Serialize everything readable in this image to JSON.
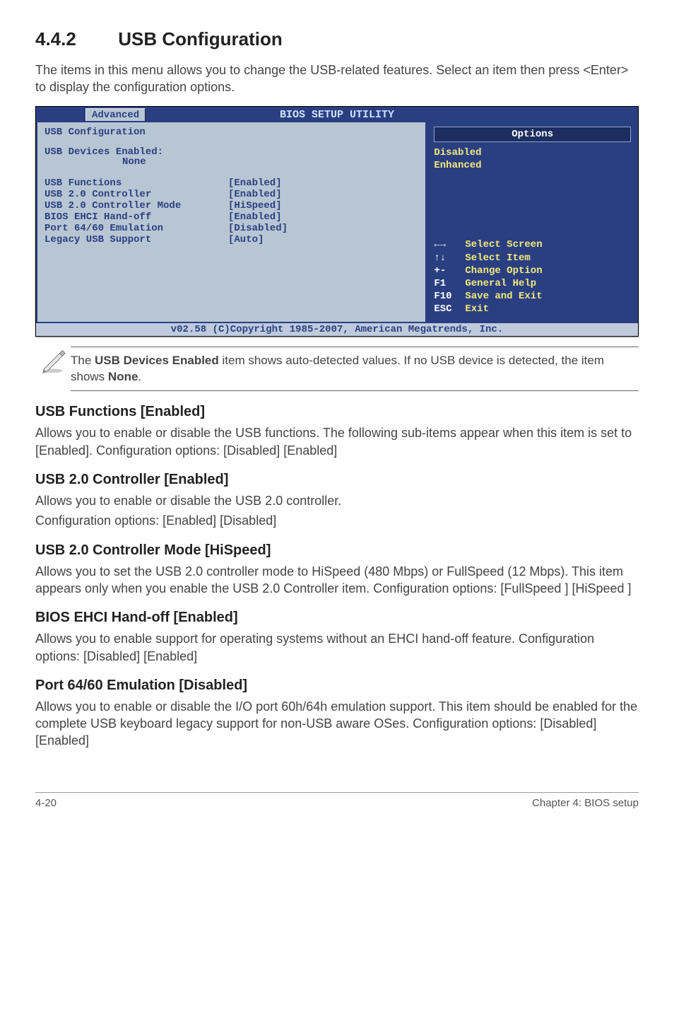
{
  "section": {
    "number": "4.4.2",
    "title": "USB Configuration"
  },
  "intro": "The items in this menu allows you to change the USB-related features. Select an item then press <Enter> to display the configuration options.",
  "bios": {
    "title": "BIOS SETUP UTILITY",
    "tab": "Advanced",
    "left": {
      "heading": "USB Configuration",
      "devices_label": "USB Devices Enabled:",
      "devices_value": "None",
      "rows": [
        {
          "label": "USB Functions",
          "value": "[Enabled]"
        },
        {
          "label": "USB 2.0 Controller",
          "value": "[Enabled]"
        },
        {
          "label": "USB 2.0 Controller Mode",
          "value": "[HiSpeed]"
        },
        {
          "label": "BIOS EHCI Hand-off",
          "value": "[Enabled]"
        },
        {
          "label": "Port 64/60 Emulation",
          "value": "[Disabled]"
        },
        {
          "label": "Legacy USB Support",
          "value": "[Auto]"
        }
      ]
    },
    "right": {
      "options_title": "Options",
      "options": [
        "Disabled",
        "Enhanced"
      ],
      "keys": [
        {
          "sym": "←→",
          "text": "Select Screen"
        },
        {
          "sym": "↑↓",
          "text": "Select Item"
        },
        {
          "sym": "+-",
          "text": "Change Option"
        },
        {
          "sym": "F1",
          "text": "General Help"
        },
        {
          "sym": "F10",
          "text": "Save and Exit"
        },
        {
          "sym": "ESC",
          "text": "Exit"
        }
      ]
    },
    "footer": "v02.58 (C)Copyright 1985-2007, American Megatrends, Inc."
  },
  "note": {
    "text_prefix": "The ",
    "bold1": "USB Devices Enabled",
    "mid": " item shows auto-detected values. If no USB device is detected, the item shows ",
    "bold2": "None",
    "suffix": "."
  },
  "subs": [
    {
      "title": "USB Functions [Enabled]",
      "paras": [
        "Allows you to enable or disable the USB functions. The following sub-items appear when this item is set to [Enabled]. Configuration options: [Disabled] [Enabled]"
      ]
    },
    {
      "title": "USB 2.0 Controller [Enabled]",
      "paras": [
        "Allows you to enable or disable the USB 2.0 controller.",
        "Configuration options: [Enabled] [Disabled]"
      ]
    },
    {
      "title": "USB 2.0 Controller Mode [HiSpeed]",
      "paras": [
        "Allows you to set the USB 2.0 controller mode to HiSpeed (480 Mbps) or FullSpeed (12 Mbps). This item appears only when you enable the USB 2.0 Controller item. Configuration options: [FullSpeed ] [HiSpeed ]"
      ]
    },
    {
      "title": "BIOS EHCI Hand-off [Enabled]",
      "paras": [
        "Allows you to enable support for operating systems without an EHCI hand-off feature. Configuration options: [Disabled] [Enabled]"
      ]
    },
    {
      "title": "Port 64/60 Emulation [Disabled]",
      "paras": [
        "Allows you to enable or disable the I/O port 60h/64h emulation support. This item should be enabled for the complete USB keyboard legacy support for non-USB aware OSes. Configuration options: [Disabled] [Enabled]"
      ]
    }
  ],
  "footer": {
    "left": "4-20",
    "right": "Chapter 4: BIOS setup"
  }
}
